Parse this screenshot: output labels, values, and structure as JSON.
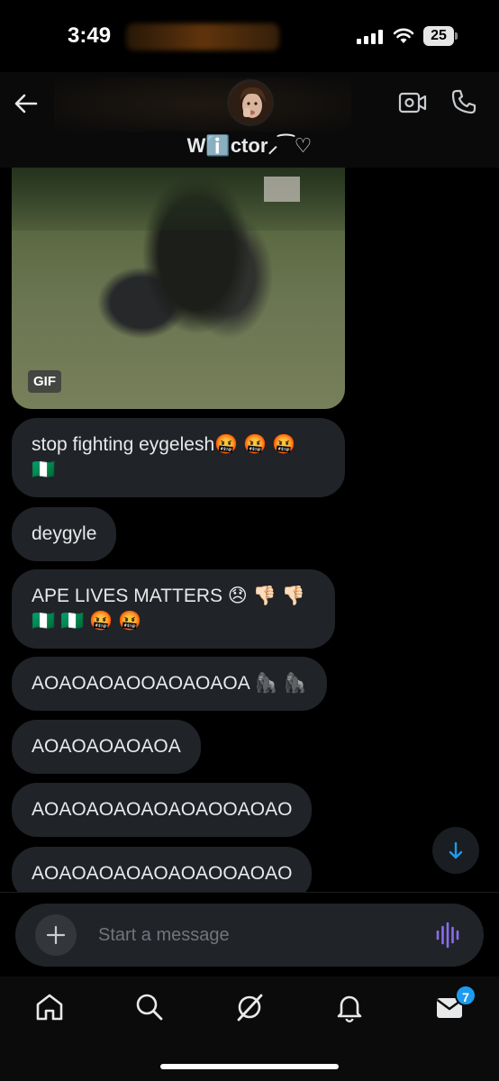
{
  "status_bar": {
    "time": "3:49",
    "battery_level": "25"
  },
  "header": {
    "contact_name": "Wℹ️ctor⸝⁀♡",
    "icons": [
      "back-arrow-icon",
      "video-call-icon",
      "phone-icon"
    ]
  },
  "messages": {
    "gif_label": "GIF",
    "items": [
      {
        "text": "stop fighting eygelesh🤬 🤬 🤬\n🇳🇬"
      },
      {
        "text": "deygyle"
      },
      {
        "text": "APE LIVES MATTERS 😞 👎🏻 👎🏻\n🇳🇬 🇳🇬 🤬 🤬"
      },
      {
        "text": "AOAOAOAOOAOAOAOA 🦍 🦍"
      },
      {
        "text": "AOAOAOAOAOA"
      },
      {
        "text": "AOAOAOAOAOAOAOOAOAO"
      },
      {
        "text": "AOAOAOAOAOAOAOOAOAO"
      }
    ]
  },
  "composer": {
    "placeholder": "Start a message"
  },
  "tab_bar": {
    "messages_badge": "7"
  },
  "colors": {
    "accent": "#1d9bf0",
    "voice_accent": "#8b6cf0",
    "bubble": "#202327",
    "background": "#000000"
  }
}
